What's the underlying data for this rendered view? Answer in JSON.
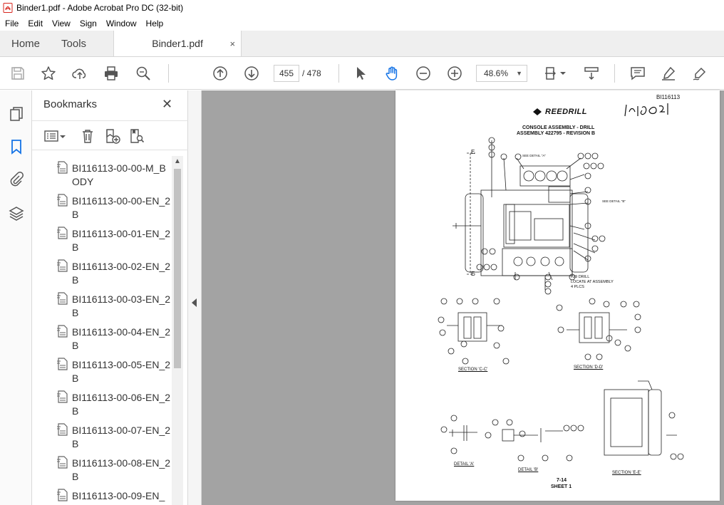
{
  "window": {
    "title": "Binder1.pdf - Adobe Acrobat Pro DC (32-bit)"
  },
  "menu": [
    "File",
    "Edit",
    "View",
    "Sign",
    "Window",
    "Help"
  ],
  "tabs": {
    "home": "Home",
    "tools": "Tools",
    "document": "Binder1.pdf",
    "close": "×"
  },
  "toolbar": {
    "current_page": "455",
    "page_total": "/ 478",
    "zoom": "48.6%"
  },
  "bookmarks": {
    "title": "Bookmarks",
    "close": "✕",
    "items": [
      "BI116113-00-00-M_BODY",
      "BI116113-00-00-EN_2B",
      "BI116113-00-01-EN_2B",
      "BI116113-00-02-EN_2B",
      "BI116113-00-03-EN_2B",
      "BI116113-00-04-EN_2B",
      "BI116113-00-05-EN_2B",
      "BI116113-00-06-EN_2B",
      "BI116113-00-07-EN_2B",
      "BI116113-00-08-EN_2B",
      "BI116113-00-09-EN_"
    ]
  },
  "document_page": {
    "doc_number": "BI116113",
    "handwritten": "1H09C21",
    "logo_text": "REEDRILL",
    "heading_line1": "CONSOLE ASSEMBLY - DRILL",
    "heading_line2": "ASSEMBLY 422795 - REVISION B",
    "note_drill": "#29 DRILL",
    "note_locate": "LOCATE AT ASSEMBLY",
    "note_plcs": "4 PLCS",
    "see_detail_a": "SEE DETAIL \"A\"",
    "see_detail_b": "SEE DETAIL \"B\"",
    "section_cc": "SECTION 'C-C'",
    "section_dd": "SECTION 'D-D'",
    "detail_a": "DETAIL 'A'",
    "detail_b": "DETAIL 'B'",
    "section_ee": "SECTION 'E-E'",
    "page_no": "7-14",
    "sheet": "SHEET 1",
    "marker_e": "E"
  },
  "colors": {
    "accent_blue": "#1473e6",
    "pdf_red": "#d7261e",
    "canvas_gray": "#a3a3a3"
  }
}
